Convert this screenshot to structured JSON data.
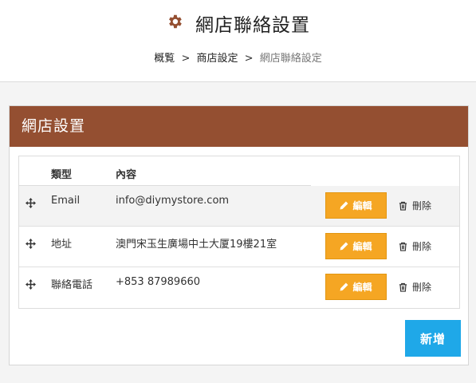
{
  "header": {
    "title": "網店聯絡設置",
    "breadcrumb": [
      {
        "label": "概覧"
      },
      {
        "label": "商店設定"
      },
      {
        "label": "網店聯絡設定"
      }
    ],
    "separator": ">"
  },
  "panel": {
    "title": "網店設置",
    "columns": {
      "type": "類型",
      "content": "內容"
    },
    "rows": [
      {
        "type": "Email",
        "content": "info@diymystore.com"
      },
      {
        "type": "地址",
        "content": "澳門宋玉生廣場中土大厦19樓21室"
      },
      {
        "type": "聯絡電話",
        "content": "+853 87989660"
      }
    ],
    "edit_label": "編輯",
    "delete_label": "刪除",
    "add_label": "新增"
  },
  "colors": {
    "panel_header": "#944f31",
    "edit_button": "#f5a623",
    "add_button": "#1fa8e8",
    "gear_icon": "#944f31"
  },
  "icons": {
    "title": "gear-icon",
    "drag": "move-arrows-icon",
    "edit": "pencil-icon",
    "delete": "trash-icon"
  }
}
